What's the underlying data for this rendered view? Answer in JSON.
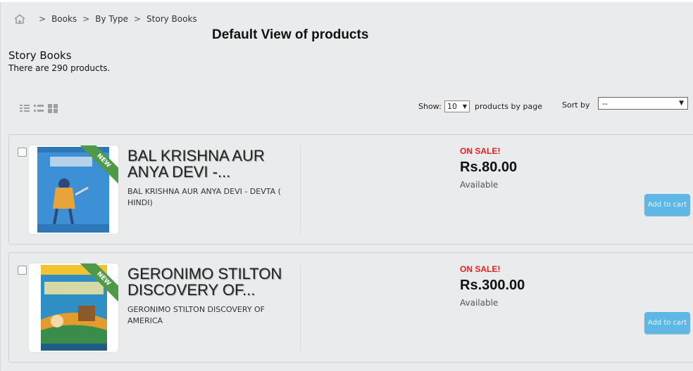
{
  "breadcrumb": {
    "home_icon": "home-icon",
    "separator": ">",
    "items": [
      "Books",
      "By Type",
      "Story Books"
    ]
  },
  "view_title": "Default View of products",
  "category": {
    "name": "Story Books",
    "count_text": "There are 290 products."
  },
  "view_modes": [
    "list-detail-icon",
    "list-icon",
    "grid-icon"
  ],
  "toolbar": {
    "show_label": "Show:",
    "per_page_value": "10",
    "per_page_suffix": "products by page",
    "sort_label": "Sort by",
    "sort_value": "--"
  },
  "products": [
    {
      "name": "BAL KRISHNA AUR ANYA DEVI -...",
      "description": "BAL KRISHNA AUR ANYA DEVI - DEVTA ( HINDI)",
      "badge": "NEW",
      "sale_label": "ON SALE!",
      "price": "Rs.80.00",
      "availability": "Available",
      "cart_label": "Add to cart",
      "cover_color": "#3d8fd6"
    },
    {
      "name": "GERONIMO STILTON DISCOVERY OF...",
      "description": "GERONIMO STILTON DISCOVERY OF AMERICA",
      "badge": "NEW",
      "sale_label": "ON SALE!",
      "price": "Rs.300.00",
      "availability": "Available",
      "cart_label": "Add to cart",
      "cover_color": "#2f8fc4"
    }
  ],
  "colors": {
    "sale": "#e02323",
    "cart_button": "#5fb7e6",
    "badge": "#4e9a48",
    "panel": "#e9ebec"
  }
}
